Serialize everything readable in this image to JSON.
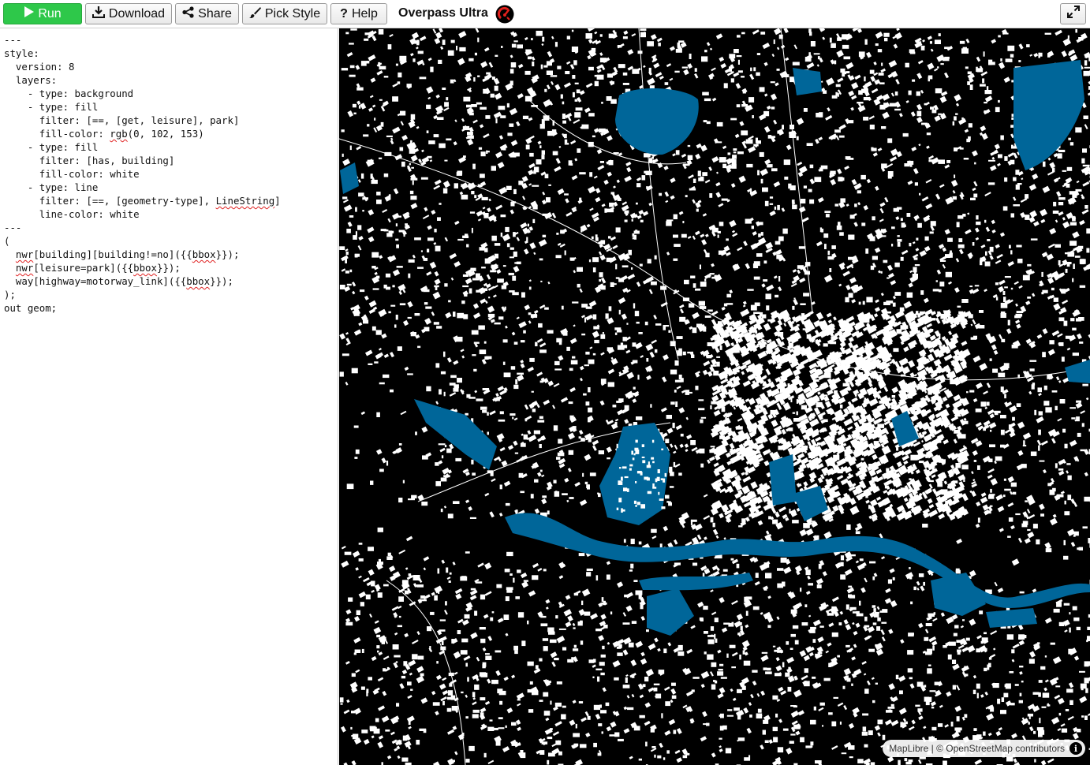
{
  "toolbar": {
    "run_label": "Run",
    "download_label": "Download",
    "share_label": "Share",
    "pick_style_label": "Pick Style",
    "help_label": "Help",
    "app_title": "Overpass Ultra"
  },
  "editor": {
    "lines": [
      "---",
      "style:",
      "  version: 8",
      "  layers:",
      "    - type: background",
      "    - type: fill",
      "      filter: [==, [get, leisure], park]",
      "      fill-color: rgb(0, 102, 153)",
      "    - type: fill",
      "      filter: [has, building]",
      "      fill-color: white",
      "    - type: line",
      "      filter: [==, [geometry-type], LineString]",
      "      line-color: white",
      "---",
      "(",
      "  nwr[building][building!=no]({{bbox}});",
      "  nwr[leisure=park]({{bbox}});",
      "  way[highway=motorway_link]({{bbox}});",
      ");",
      "out geom;"
    ]
  },
  "map": {
    "background_color": "#000000",
    "building_color": "#ffffff",
    "park_color": "#006699",
    "attribution": "MapLibre | © OpenStreetMap contributors"
  },
  "colors": {
    "run_green": "#2ec84a",
    "park_blue": "#006699"
  }
}
